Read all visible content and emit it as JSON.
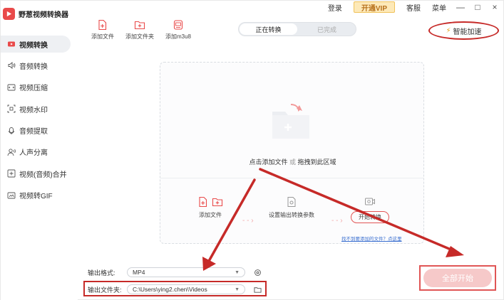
{
  "app": {
    "name": "野葱视频转换器"
  },
  "topbar": {
    "login": "登录",
    "vip": "开通VIP",
    "service": "客服",
    "menu": "菜单",
    "minimize": "—",
    "maximize": "□",
    "close": "×"
  },
  "sidebar": {
    "items": [
      {
        "label": "视频转换",
        "icon": "video-convert-icon",
        "active": true
      },
      {
        "label": "音频转换",
        "icon": "audio-convert-icon"
      },
      {
        "label": "视频压缩",
        "icon": "compress-icon"
      },
      {
        "label": "视频水印",
        "icon": "watermark-icon"
      },
      {
        "label": "音频提取",
        "icon": "audio-extract-icon"
      },
      {
        "label": "人声分离",
        "icon": "voice-split-icon"
      },
      {
        "label": "视频(音频)合并",
        "icon": "merge-icon"
      },
      {
        "label": "视频转GIF",
        "icon": "gif-icon"
      }
    ]
  },
  "toolbar": {
    "add_file": "添加文件",
    "add_folder": "添加文件夹",
    "add_m3u8": "添加m3u8"
  },
  "tabs": {
    "converting": "正在转换",
    "done": "已完成"
  },
  "accelerate": "智能加速",
  "dropzone": {
    "prompt": "点击添加文件",
    "or": "或",
    "prompt2": "拖拽到此区域",
    "step1": "添加文件",
    "step2": "设置输出转换参数",
    "step3": "开始转换",
    "help": "找不到要添加的文件？点这里"
  },
  "output": {
    "format_label": "输出格式:",
    "format_value": "MP4",
    "folder_label": "输出文件夹:",
    "folder_value": "C:\\Users\\ying2.chen\\Videos"
  },
  "start_all": "全部开始",
  "colors": {
    "accent": "#e94a4a",
    "annotation": "#c62a28",
    "vip_bg": "#fde9b8"
  }
}
